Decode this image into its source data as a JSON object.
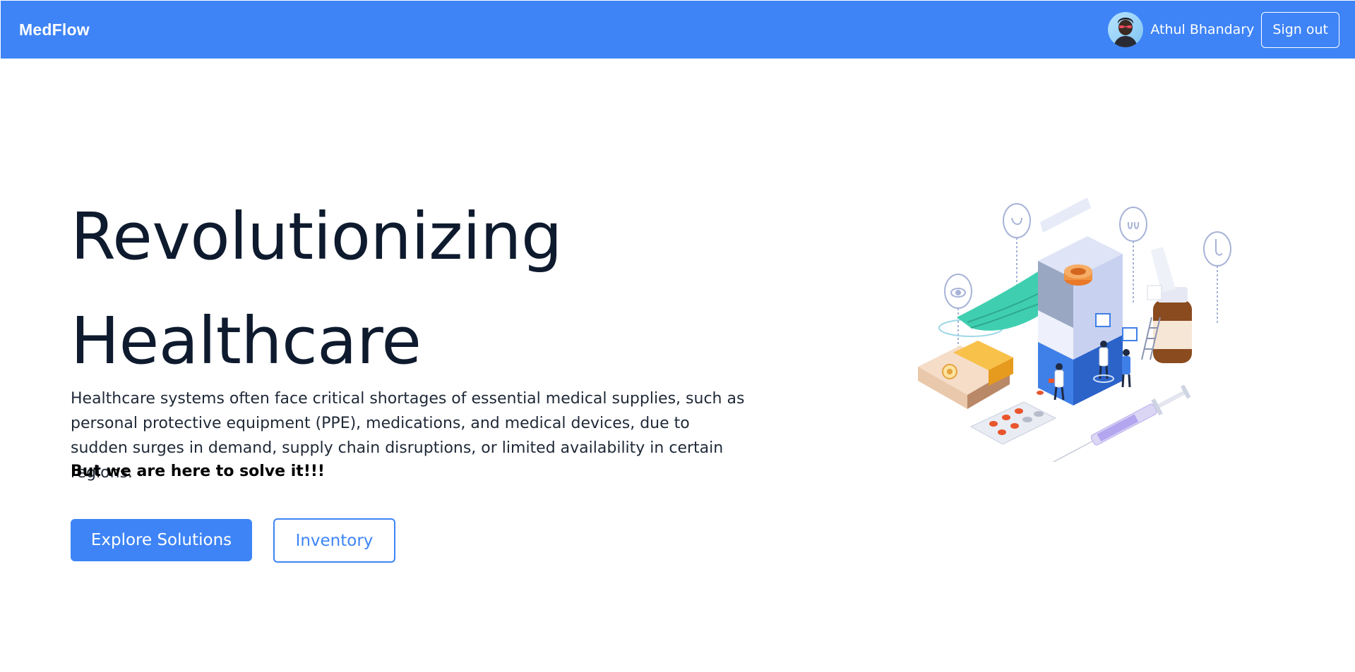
{
  "navbar": {
    "brand": "MedFlow",
    "user_name": "Athul Bhandary",
    "signout_label": "Sign out",
    "avatar_icon": "user-avatar",
    "background_color": "#3e84f6"
  },
  "hero": {
    "title_line1": "Revolutionizing",
    "title_line2": "Healthcare",
    "description": "Healthcare systems often face critical shortages of essential medical supplies, such as personal protective equipment (PPE), medications, and medical devices, due to sudden surges in demand, supply chain disruptions, or limited availability in certain regions.",
    "emphasis": "But we are here to solve it!!!",
    "primary_button": "Explore Solutions",
    "secondary_button": "Inventory",
    "illustration_icon": "medical-supplies-illustration"
  },
  "colors": {
    "accent": "#3e84f6",
    "title_text": "#0e1a2d",
    "body_text": "#1f2937"
  }
}
